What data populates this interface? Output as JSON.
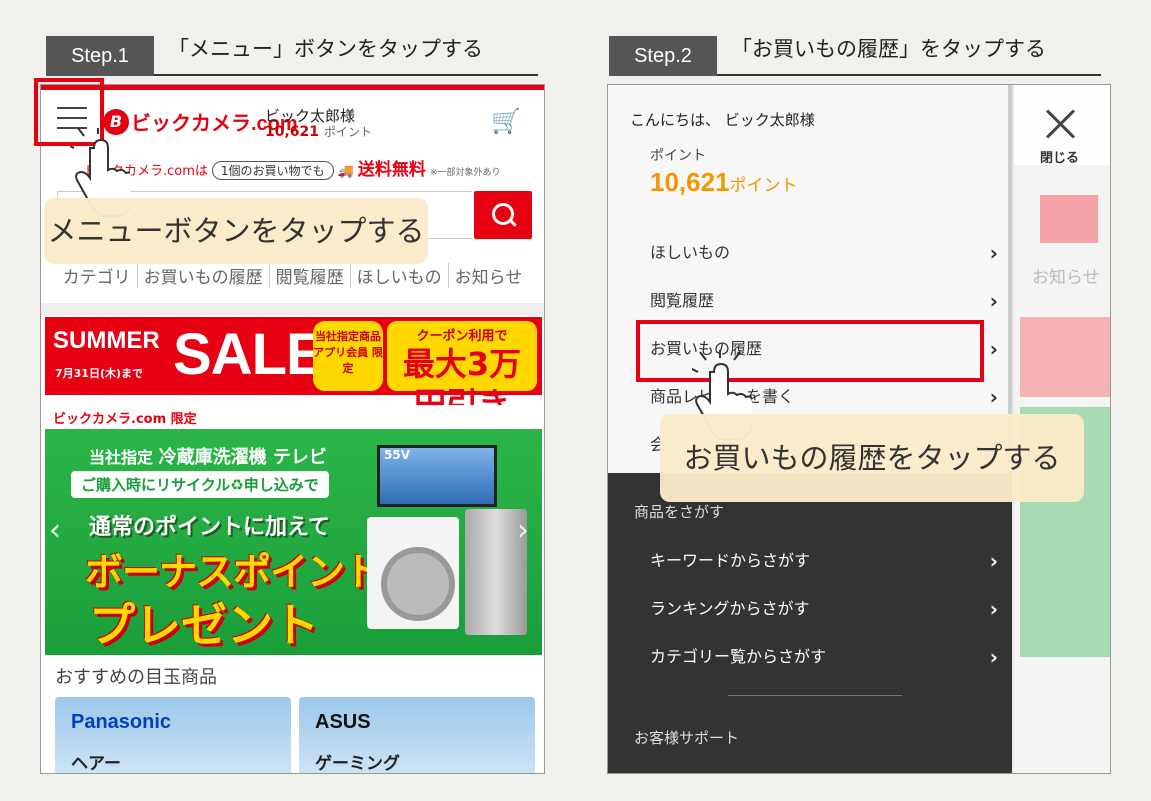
{
  "step1": {
    "tag": "Step.1",
    "caption": "「メニュー」ボタンをタップする",
    "header": {
      "logo": "ビックカメラ.com",
      "user_name": "ビック太郎様",
      "points": "10,621",
      "points_unit": "ポイント"
    },
    "shipping": {
      "lead": "ビックカメラ.comは",
      "pill": "1個のお買い物でも",
      "free": "送料無料",
      "note": "※一部対象外あり"
    },
    "tabs": [
      "カテゴリ",
      "お買いもの履歴",
      "閲覧履歴",
      "ほしいもの",
      "お知らせ"
    ],
    "sale_banner": {
      "summer": "SUMMER",
      "sale": "SALE",
      "date": "7月31日(木)まで",
      "badge": "当社指定商品 アプリ会員 限定",
      "coupon_top": "クーポン利用で",
      "coupon_amount": "最大3万円引き"
    },
    "promo_banner": {
      "limited": "ビックカメラ.com 限定",
      "products_prefix": "当社指定",
      "products": "冷蔵庫洗濯機 テレビ",
      "recycle": "ご購入時にリサイクル♻申し込みで",
      "line3": "通常のポイントに加えて",
      "line4": "ボーナスポイント",
      "line5": "プレゼント",
      "tv_size": "55V"
    },
    "featured_title": "おすすめの目玉商品",
    "cards": [
      {
        "brand": "Panasonic",
        "sub": "ヘアー"
      },
      {
        "brand": "ASUS",
        "sub": "ゲーミング"
      }
    ],
    "callout": "メニューボタンをタップする"
  },
  "step2": {
    "tag": "Step.2",
    "caption": "「お買いもの履歴」をタップする",
    "greeting": "こんにちは、 ビック太郎様",
    "points_label": "ポイント",
    "points_value": "10,621",
    "points_unit": "ポイント",
    "menu": [
      "ほしいもの",
      "閲覧履歴",
      "お買いもの履歴",
      "商品レビューを書く"
    ],
    "menu_hidden_fragment": "会",
    "section_search": "商品をさがす",
    "search_menu": [
      "キーワードからさがす",
      "ランキングからさがす",
      "カテゴリー覧からさがす"
    ],
    "section_support": "お客様サポート",
    "close_label": "閉じる",
    "behind_text": "お知らせ",
    "callout": "お買いもの履歴をタップする"
  },
  "colors": {
    "brand_red": "#e60012",
    "points_orange": "#f39800",
    "step_tag": "#555555",
    "callout_bg": "#faeac8"
  }
}
